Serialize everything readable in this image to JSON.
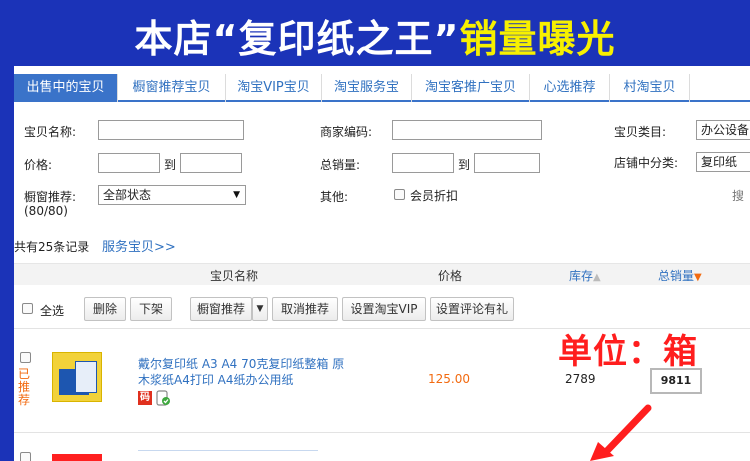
{
  "banner": {
    "title_part1": "本店“复印纸之王”",
    "title_part2": "销量曝光",
    "accent_color": "#f7f000",
    "background_color": "#1b33b8"
  },
  "tabs": [
    {
      "label": "出售中的宝贝",
      "active": true
    },
    {
      "label": "橱窗推荐宝贝",
      "active": false
    },
    {
      "label": "淘宝VIP宝贝",
      "active": false
    },
    {
      "label": "淘宝服务宝",
      "active": false
    },
    {
      "label": "淘宝客推广宝贝",
      "active": false
    },
    {
      "label": "心选推荐",
      "active": false
    },
    {
      "label": "村淘宝贝",
      "active": false
    }
  ],
  "search": {
    "item_name_label": "宝贝名称:",
    "merchant_code_label": "商家编码:",
    "category_label": "宝贝类目:",
    "category_value": "办公设备",
    "price_label": "价格:",
    "to_label": "到",
    "total_sales_label": "总销量:",
    "shop_category_label": "店铺中分类:",
    "shop_category_value": "复印纸",
    "window_rec_label": "橱窗推荐:",
    "window_rec_count": "(80/80)",
    "status_value": "全部状态",
    "other_label": "其他:",
    "member_discount_label": "会员折扣",
    "search_button_partial": "搜"
  },
  "summary": {
    "total_text": "共有25条记录",
    "service_link": "服务宝贝>>"
  },
  "table": {
    "headers": {
      "item_name": "宝贝名称",
      "price": "价格",
      "stock": "库存",
      "total_sales": "总销量"
    },
    "sort_icons": {
      "stock": "sort-up-icon",
      "total_sales": "sort-down-icon"
    },
    "toolbar": {
      "select_all": "全选",
      "delete": "删除",
      "delist": "下架",
      "window_recommend": "橱窗推荐",
      "cancel_recommend": "取消推荐",
      "set_vip": "设置淘宝VIP",
      "set_review_gift": "设置评论有礼"
    },
    "rows": [
      {
        "recommended_badge": "已推荐",
        "title": "戴尔复印纸 A3 A4 70克复印纸整箱 原木浆纸A4打印 A4纸办公用纸",
        "code_badge": "码",
        "price": "125.00",
        "stock": "2789",
        "total_sales": "9811"
      }
    ]
  },
  "annotation": {
    "unit_note": "单位：箱",
    "color": "#ff1e1e"
  }
}
